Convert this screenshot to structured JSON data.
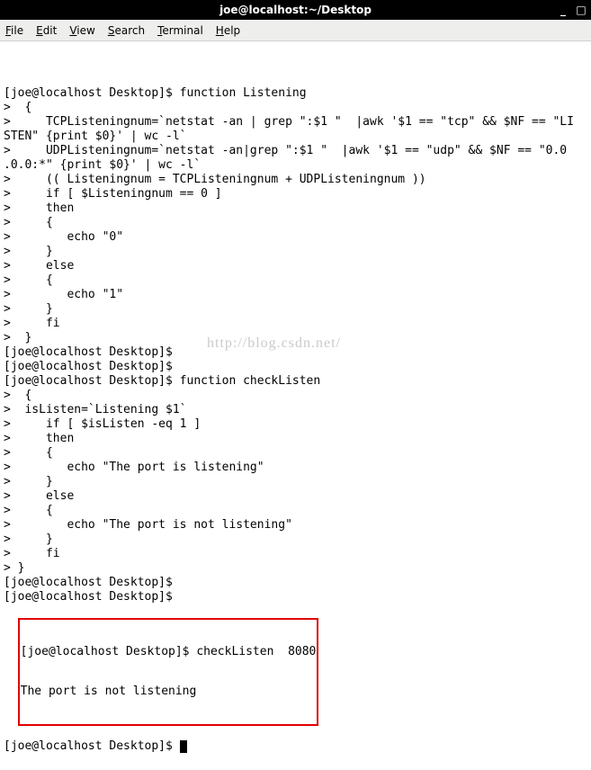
{
  "titlebar": {
    "title": "joe@localhost:~/Desktop"
  },
  "menubar": {
    "items": [
      {
        "label": "File",
        "accel": "F"
      },
      {
        "label": "Edit",
        "accel": "E"
      },
      {
        "label": "View",
        "accel": "V"
      },
      {
        "label": "Search",
        "accel": "S"
      },
      {
        "label": "Terminal",
        "accel": "T"
      },
      {
        "label": "Help",
        "accel": "H"
      }
    ]
  },
  "watermark": "http://blog.csdn.net/",
  "terminal": {
    "prompt": "[joe@localhost Desktop]$ ",
    "lines": [
      "[joe@localhost Desktop]$ function Listening",
      ">  {",
      ">     TCPListeningnum=`netstat -an | grep \":$1 \"  |awk '$1 == \"tcp\" && $NF == \"LI",
      "STEN\" {print $0}' | wc -l`",
      ">     UDPListeningnum=`netstat -an|grep \":$1 \"  |awk '$1 == \"udp\" && $NF == \"0.0",
      ".0.0:*\" {print $0}' | wc -l`",
      ">     (( Listeningnum = TCPListeningnum + UDPListeningnum ))",
      ">     if [ $Listeningnum == 0 ]",
      ">     then",
      ">     {",
      ">        echo \"0\"",
      ">     }",
      ">     else",
      ">     {",
      ">        echo \"1\"",
      ">     }",
      ">     fi",
      ">  }",
      "[joe@localhost Desktop]$ ",
      "[joe@localhost Desktop]$ ",
      "[joe@localhost Desktop]$ function checkListen",
      ">  {",
      ">  isListen=`Listening $1`",
      ">     if [ $isListen -eq 1 ]",
      ">     then",
      ">     {",
      ">        echo \"The port is listening\"",
      ">     }",
      ">     else",
      ">     {",
      ">        echo \"The port is not listening\"",
      ">     }",
      ">     fi",
      "> }",
      "[joe@localhost Desktop]$ ",
      "[joe@localhost Desktop]$ "
    ],
    "highlighted": [
      "[joe@localhost Desktop]$ checkListen  8080",
      "The port is not listening"
    ],
    "final_prompt": "[joe@localhost Desktop]$ "
  }
}
